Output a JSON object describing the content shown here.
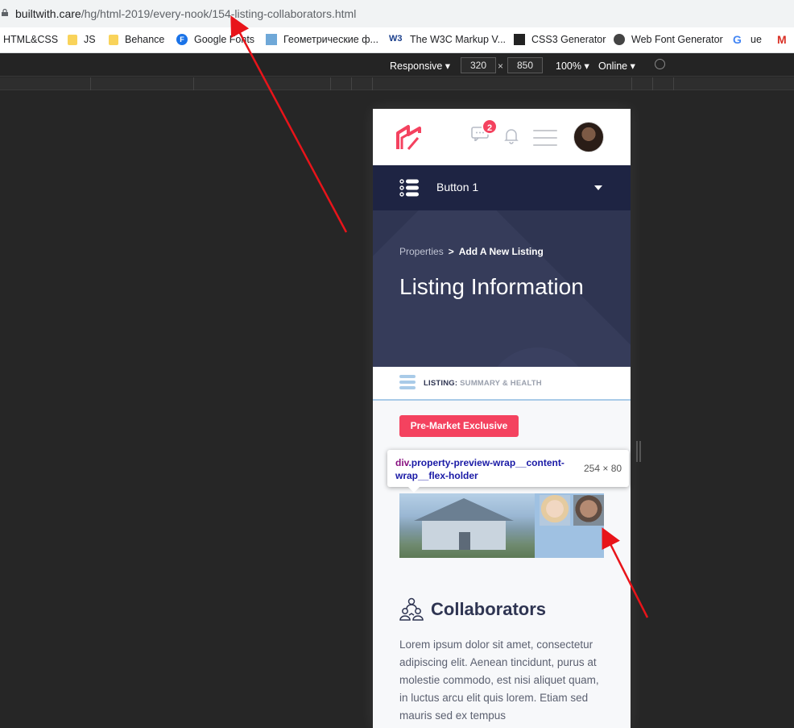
{
  "browser": {
    "url_host": "builtwith.care",
    "url_path": "/hg/html-2019/every-nook/154-listing-collaborators.html"
  },
  "bookmarks": [
    {
      "label": "HTML&CSS",
      "icon": "none"
    },
    {
      "label": "JS",
      "icon": "folder-icon"
    },
    {
      "label": "Behance",
      "icon": "folder-icon"
    },
    {
      "label": "Google Fonts",
      "icon": "google-fonts-icon"
    },
    {
      "label": "Геометрические ф...",
      "icon": "geometric-icon"
    },
    {
      "label": "The W3C Markup V...",
      "icon": "w3c-icon"
    },
    {
      "label": "CSS3 Generator",
      "icon": "css3-icon"
    },
    {
      "label": "Web Font Generator",
      "icon": "web-icon"
    },
    {
      "label": "ue",
      "icon": "google-icon"
    },
    {
      "label": "",
      "icon": "gmail-icon"
    }
  ],
  "devtools": {
    "device": "Responsive",
    "width": "320",
    "height": "850",
    "zoom": "100%",
    "network": "Online",
    "times": "×"
  },
  "app": {
    "message_count": "2",
    "nav_button": "Button 1",
    "breadcrumb": {
      "parent": "Properties",
      "separator": ">",
      "current": "Add A New Listing"
    },
    "title": "Listing Information",
    "subnav": {
      "prefix": "LISTING:",
      "label": "SUMMARY & HEALTH"
    },
    "tag_button": "Pre-Market Exclusive",
    "tooltip": {
      "tag": "div",
      "selector": ".property-preview-wrap__content-wrap__flex-holder",
      "size": "254 × 80"
    },
    "section_title": "Collaborators",
    "body_text": "Lorem ipsum dolor sit amet, consectetur adipiscing elit. Aenean tincidunt, purus at molestie commodo, est nisi aliquet quam, in luctus arcu elit quis lorem. Etiam sed mauris sed ex tempus"
  },
  "colors": {
    "accent": "#f4425f",
    "navy": "#1e2443",
    "hero": "#2f3552",
    "annotation": "#e8141a"
  }
}
